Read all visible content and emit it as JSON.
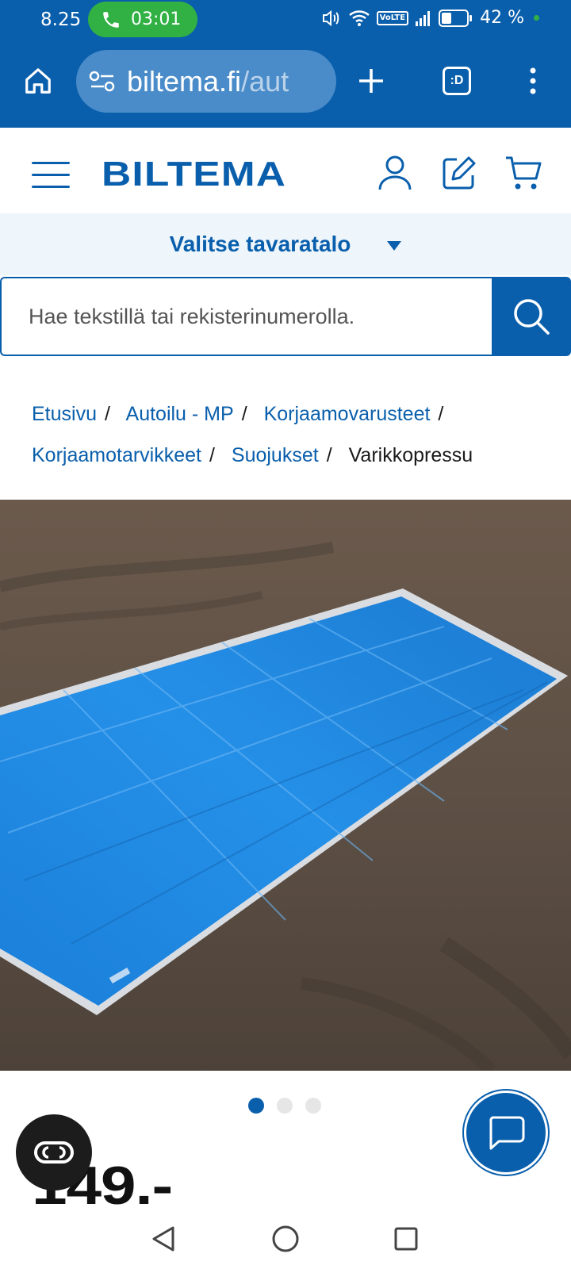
{
  "status_bar": {
    "time": "8.25",
    "call_duration": "03:01",
    "volte_label": "VoLTE",
    "battery_percent": "42 %",
    "battery_level": 0.42
  },
  "browser": {
    "url_domain": "biltema.fi",
    "url_path": "/aut",
    "tab_count_label": ":D"
  },
  "header": {
    "logo_text": "BILTEMA"
  },
  "store_selector": {
    "label": "Valitse tavaratalo"
  },
  "search": {
    "placeholder": "Hae tekstillä tai rekisterinumerolla."
  },
  "breadcrumb": {
    "separator": "/",
    "items": [
      "Etusivu",
      "Autoilu - MP",
      "Korjaamovarusteet",
      "Korjaamotarvikkeet",
      "Suojukset"
    ],
    "current": "Varikkopressu"
  },
  "carousel": {
    "total": 3,
    "active_index": 0
  },
  "product": {
    "price": "149.-"
  },
  "colors": {
    "brand_blue": "#0a5fac",
    "call_green": "#31b044",
    "tarp_blue": "#1e84dc"
  },
  "icons": {
    "home": "home-icon",
    "site_settings": "site-settings-icon",
    "new_tab": "plus-icon",
    "tabs": "tab-switcher-icon",
    "menu": "more-vert-icon",
    "account": "user-icon",
    "list": "edit-icon",
    "cart": "cart-icon",
    "search": "search-icon",
    "chat": "chat-icon",
    "cookie": "cookie-settings-icon"
  }
}
